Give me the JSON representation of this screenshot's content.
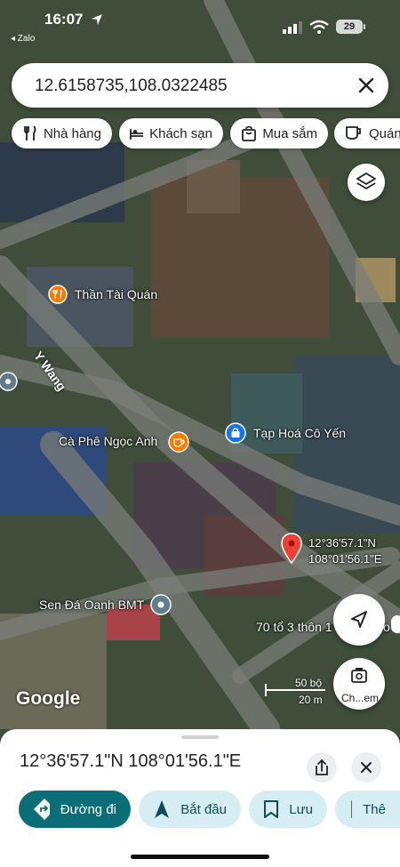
{
  "status_bar": {
    "time": "16:07",
    "back_label": "◂ Zalo",
    "battery": "29"
  },
  "search": {
    "value": "12.6158735,108.0322485"
  },
  "chips": [
    {
      "label": "Nhà hàng",
      "icon": "fork-knife-icon"
    },
    {
      "label": "Khách sạn",
      "icon": "bed-icon"
    },
    {
      "label": "Mua sắm",
      "icon": "shopping-bag-icon"
    },
    {
      "label": "Quán",
      "icon": "coffee-cup-icon"
    }
  ],
  "map": {
    "street_label": "Y Wang",
    "pois": [
      {
        "name": "Thần Tài Quán",
        "icon": "food-icon",
        "color": "#f57c00"
      },
      {
        "name": "Cà Phê Ngọc Anh",
        "icon": "coffee-icon",
        "color": "#f57c00"
      },
      {
        "name": "Tạp Hoá Cô Yến",
        "icon": "shopping-bag-icon",
        "color": "#1a73e8"
      },
      {
        "name": "Sen Đá Oanh BMT",
        "icon": "place-icon",
        "color": "#607d8b"
      }
    ],
    "pin": {
      "lat": "12°36'57.1\"N",
      "lng": "108°01'56.1\"E",
      "color": "#ea4335"
    },
    "address_partial": "70 tổ 3 thôn 1",
    "address_tail": "o",
    "scale": {
      "top": "50 bộ",
      "bottom": "20 m"
    },
    "google_logo": "Google",
    "camera_label": "Ch...em"
  },
  "sheet": {
    "coords": "12°36'57.1\"N 108°01'56.1\"E",
    "actions": [
      {
        "label": "Đường đi",
        "icon": "directions-icon"
      },
      {
        "label": "Bắt đầu",
        "icon": "navigation-arrow-icon"
      },
      {
        "label": "Lưu",
        "icon": "bookmark-icon"
      },
      {
        "label": "Thê",
        "icon": "flag-icon"
      }
    ]
  },
  "colors": {
    "accent": "#0b6e77",
    "secondary_btn": "#d6eef3",
    "pin": "#ea4335"
  }
}
